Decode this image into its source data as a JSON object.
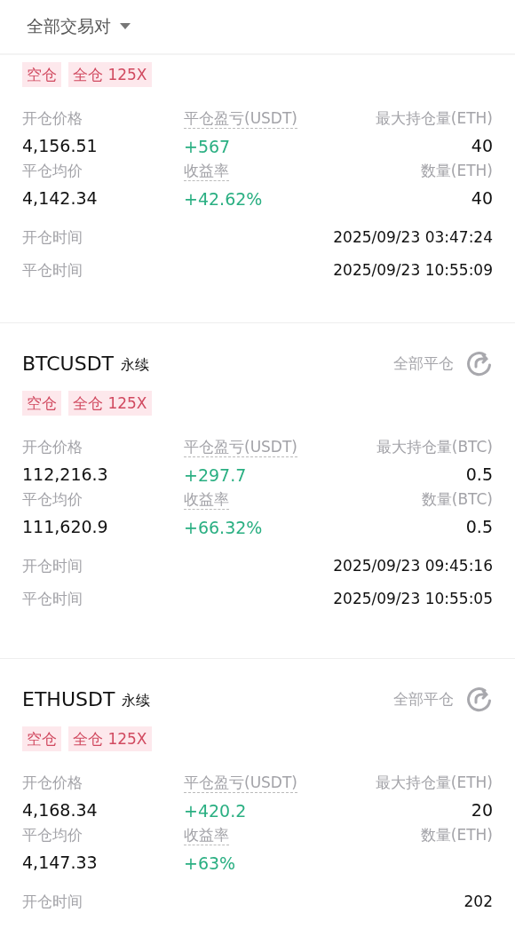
{
  "header": {
    "filter_label": "全部交易对"
  },
  "positions": [
    {
      "tags": [
        "空仓",
        "全仓 125X"
      ],
      "metrics": [
        {
          "label": "开仓价格",
          "value": "4,156.51",
          "kind": "plain",
          "dotted": false
        },
        {
          "label": "平仓盈亏(USDT)",
          "value": "+567",
          "kind": "gain",
          "dotted": true
        },
        {
          "label": "最大持仓量(ETH)",
          "value": "40",
          "kind": "plain",
          "dotted": false
        },
        {
          "label": "平仓均价",
          "value": "4,142.34",
          "kind": "plain",
          "dotted": false
        },
        {
          "label": "收益率",
          "value": "+42.62%",
          "kind": "gain",
          "dotted": true
        },
        {
          "label": "数量(ETH)",
          "value": "40",
          "kind": "plain",
          "dotted": false
        }
      ],
      "times": [
        {
          "label": "开仓时间",
          "value": "2025/09/23 03:47:24"
        },
        {
          "label": "平仓时间",
          "value": "2025/09/23 10:55:09"
        }
      ]
    },
    {
      "symbol": "BTCUSDT",
      "contract_type": "永续",
      "close_all": "全部平仓",
      "tags": [
        "空仓",
        "全仓 125X"
      ],
      "metrics": [
        {
          "label": "开仓价格",
          "value": "112,216.3",
          "kind": "plain",
          "dotted": false
        },
        {
          "label": "平仓盈亏(USDT)",
          "value": "+297.7",
          "kind": "gain",
          "dotted": true
        },
        {
          "label": "最大持仓量(BTC)",
          "value": "0.5",
          "kind": "plain",
          "dotted": false
        },
        {
          "label": "平仓均价",
          "value": "111,620.9",
          "kind": "plain",
          "dotted": false
        },
        {
          "label": "收益率",
          "value": "+66.32%",
          "kind": "gain",
          "dotted": true
        },
        {
          "label": "数量(BTC)",
          "value": "0.5",
          "kind": "plain",
          "dotted": false
        }
      ],
      "times": [
        {
          "label": "开仓时间",
          "value": "2025/09/23 09:45:16"
        },
        {
          "label": "平仓时间",
          "value": "2025/09/23 10:55:05"
        }
      ]
    },
    {
      "symbol": "ETHUSDT",
      "contract_type": "永续",
      "close_all": "全部平仓",
      "tags": [
        "空仓",
        "全仓 125X"
      ],
      "metrics": [
        {
          "label": "开仓价格",
          "value": "4,168.34",
          "kind": "plain",
          "dotted": false
        },
        {
          "label": "平仓盈亏(USDT)",
          "value": "+420.2",
          "kind": "gain",
          "dotted": true
        },
        {
          "label": "最大持仓量(ETH)",
          "value": "20",
          "kind": "plain",
          "dotted": false
        },
        {
          "label": "平仓均价",
          "value": "4,147.33",
          "kind": "plain",
          "dotted": false
        },
        {
          "label": "收益率",
          "value": "+63%",
          "kind": "gain",
          "dotted": true
        },
        {
          "label": "数量(ETH)",
          "dotted": false
        }
      ],
      "times": [
        {
          "label": "开仓时间",
          "value": "202"
        }
      ]
    }
  ]
}
